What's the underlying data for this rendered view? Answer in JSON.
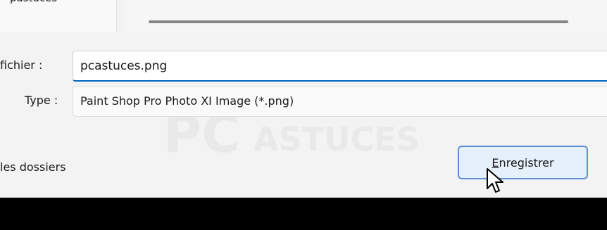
{
  "sidebar": {
    "partial_item_label": "pastuces"
  },
  "watermark": {
    "text_pc": "PC",
    "text_astuces": "ASTUCES"
  },
  "filename": {
    "label": "fichier :",
    "value": "pcastuces.png"
  },
  "filetype": {
    "label": "Type :",
    "value": "Paint Shop Pro Photo XI Image (*.png)"
  },
  "folders_toggle": {
    "label": "les dossiers"
  },
  "save_button": {
    "mnemonic": "E",
    "label_rest": "nregistrer"
  },
  "colors": {
    "accent": "#0067c0",
    "button_border": "#5b8fd0",
    "button_fill": "#e6f0fb"
  },
  "icons": {
    "cursor": "mouse-pointer-icon"
  }
}
